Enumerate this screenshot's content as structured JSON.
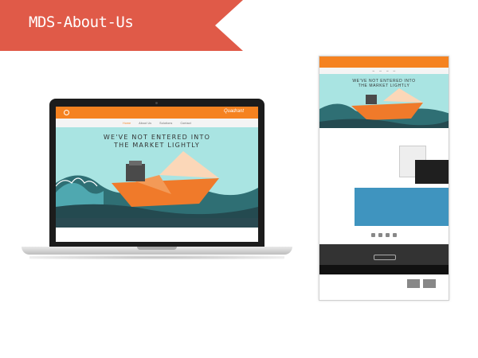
{
  "banner": {
    "title": "MDS-About-Us"
  },
  "colors": {
    "banner": "#e05a48",
    "brand_orange": "#f58220",
    "hero_teal": "#a9e4e2",
    "accent_blue": "#3f94bf"
  },
  "laptop_site": {
    "brand": "Quadrant",
    "nav": [
      "Home",
      "About Us",
      "Solutions",
      "Contact"
    ],
    "headline_line1": "WE'VE NOT ENTERED INTO",
    "headline_line2": "THE MARKET LIGHTLY"
  },
  "mobile_site": {
    "headline_line1": "WE'VE NOT ENTERED INTO",
    "headline_line2": "THE MARKET LIGHTLY"
  }
}
